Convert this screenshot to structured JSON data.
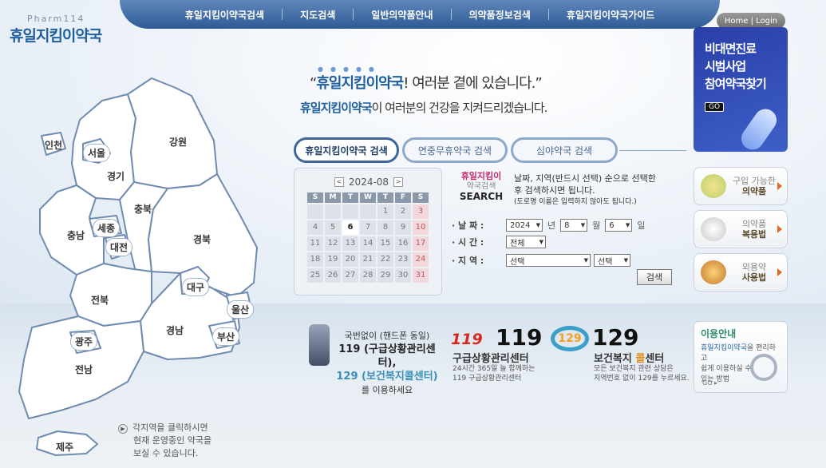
{
  "brand": {
    "sub": "Pharm114",
    "name": "휴일지킴이약국"
  },
  "nav": [
    "휴일지킴이약국검색",
    "지도검색",
    "일반의약품안내",
    "의약품정보검색",
    "휴일지킴이약국가이드"
  ],
  "home_login": "Home | Login",
  "slogan": {
    "line1_open": "“",
    "line1_brand": "휴일지킴이약국",
    "line1_rest": "! 여러분 곁에 있습니다.”",
    "line2_brand": "휴일지킴이약국",
    "line2_rest": "이 여러분의 건강을 지켜드리겠습니다."
  },
  "tabs": [
    "휴일지킴이약국 검색",
    "연중무휴약국 검색",
    "심야약국 검색"
  ],
  "calendar": {
    "month": "2024-08",
    "prev": "<",
    "next": ">",
    "day_headers": [
      "S",
      "M",
      "T",
      "W",
      "T",
      "F",
      "S"
    ],
    "days": [
      "",
      "",
      "",
      "",
      "1",
      "2",
      "3",
      "4",
      "5",
      "6",
      "7",
      "8",
      "9",
      "10",
      "11",
      "12",
      "13",
      "14",
      "15",
      "16",
      "17",
      "18",
      "19",
      "20",
      "21",
      "22",
      "23",
      "24",
      "25",
      "26",
      "27",
      "28",
      "29",
      "30",
      "31"
    ],
    "today": "6"
  },
  "search": {
    "label1": "휴일지킴이",
    "label2": "약국검색",
    "label3": "SEARCH",
    "desc1": "날짜, 지역(반드시 선택) 순으로 선택한",
    "desc2": "후 검색하시면 됩니다.",
    "desc3": "(도로명 이름은 입력하지 않아도 됩니다.)",
    "date_label": "· 날 짜 :",
    "year": "2024",
    "year_unit": "년",
    "month": "8",
    "month_unit": "월",
    "day": "6",
    "day_unit": "일",
    "time_label": "· 시 간 :",
    "time": "전체",
    "region_label": "· 지 역 :",
    "region1": "선택",
    "region2": "선택",
    "button": "검색"
  },
  "banner": {
    "line1": "비대면진료",
    "line2": "시범사업",
    "line3": "참여약국찾기",
    "go": "GO"
  },
  "side_links": [
    {
      "pre": "구입 가능한",
      "main": "의약품"
    },
    {
      "pre": "의약품",
      "main": "복용법"
    },
    {
      "pre": "외용약",
      "main": "사용법"
    }
  ],
  "map": {
    "regions": [
      "인천",
      "서울",
      "경기",
      "강원",
      "충북",
      "충남",
      "세종",
      "대전",
      "경북",
      "대구",
      "전북",
      "울산",
      "경남",
      "부산",
      "광주",
      "전남",
      "제주"
    ],
    "note1": "각지역을 클릭하시면",
    "note2": "현재 운영중인 약국을",
    "note3": "보실 수 있습니다."
  },
  "info": {
    "l1": "국번없이 (핸드폰 동일)",
    "l2": "119 (구급상황관리센터),",
    "l3": "129 (보건복지콜센터)",
    "l4": "를 이용하세요",
    "c119_logo": "119",
    "c119_num": "119",
    "c119_name": "구급상황관리센터",
    "c119_d1": "24시간 365일 늘 함께하는",
    "c119_d2": "119 구급상황관리센터",
    "c129_logo": "129",
    "c129_num": "129",
    "c129_name_a": "보건복지 ",
    "c129_name_b": "콜",
    "c129_name_c": "센터",
    "c129_d1": "모든 보건복지 관련 상담은",
    "c129_d2": "지역번호 없이 129를 누르세요."
  },
  "guide": {
    "title": "이용안내",
    "d1_brand": "휴일지킴이약국",
    "d1": "을 편리하고",
    "d2": "쉽게 이용하실 수",
    "d3": "있는 방법",
    "go": "GO ▸"
  }
}
